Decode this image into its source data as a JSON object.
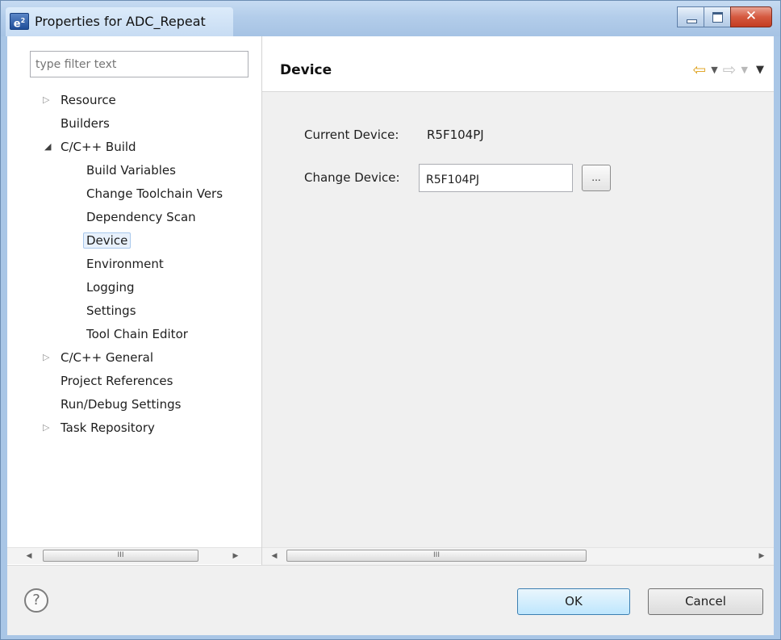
{
  "window": {
    "title": "Properties for ADC_Repeat",
    "app_icon": "e²"
  },
  "filter": {
    "placeholder": "type filter text"
  },
  "tree": {
    "items": [
      {
        "label": "Resource",
        "twisty": "collapsed"
      },
      {
        "label": "Builders",
        "twisty": "none"
      },
      {
        "label": "C/C++ Build",
        "twisty": "expanded"
      },
      {
        "label": "Build Variables",
        "twisty": "none"
      },
      {
        "label": "Change Toolchain Vers",
        "twisty": "none"
      },
      {
        "label": "Dependency Scan",
        "twisty": "none"
      },
      {
        "label": "Device",
        "twisty": "none",
        "selected": true
      },
      {
        "label": "Environment",
        "twisty": "none"
      },
      {
        "label": "Logging",
        "twisty": "none"
      },
      {
        "label": "Settings",
        "twisty": "none"
      },
      {
        "label": "Tool Chain Editor",
        "twisty": "none"
      },
      {
        "label": "C/C++ General",
        "twisty": "collapsed"
      },
      {
        "label": "Project References",
        "twisty": "none"
      },
      {
        "label": "Run/Debug Settings",
        "twisty": "none"
      },
      {
        "label": "Task Repository",
        "twisty": "collapsed"
      }
    ]
  },
  "page": {
    "title": "Device",
    "current_device_label": "Current Device:",
    "current_device_value": "R5F104PJ",
    "change_device_label": "Change Device:",
    "change_device_value": "R5F104PJ",
    "browse_label": "..."
  },
  "nav": {
    "back_icon": "arrow-left-icon",
    "forward_icon": "arrow-right-icon"
  },
  "scroll": {
    "grip": "III"
  },
  "footer": {
    "help_label": "?",
    "ok_label": "OK",
    "cancel_label": "Cancel"
  },
  "colors": {
    "title_bar": "#b3cdea",
    "close_button": "#d5593f",
    "selection": "#e8f1fc",
    "back_arrow": "#e0a72b"
  }
}
